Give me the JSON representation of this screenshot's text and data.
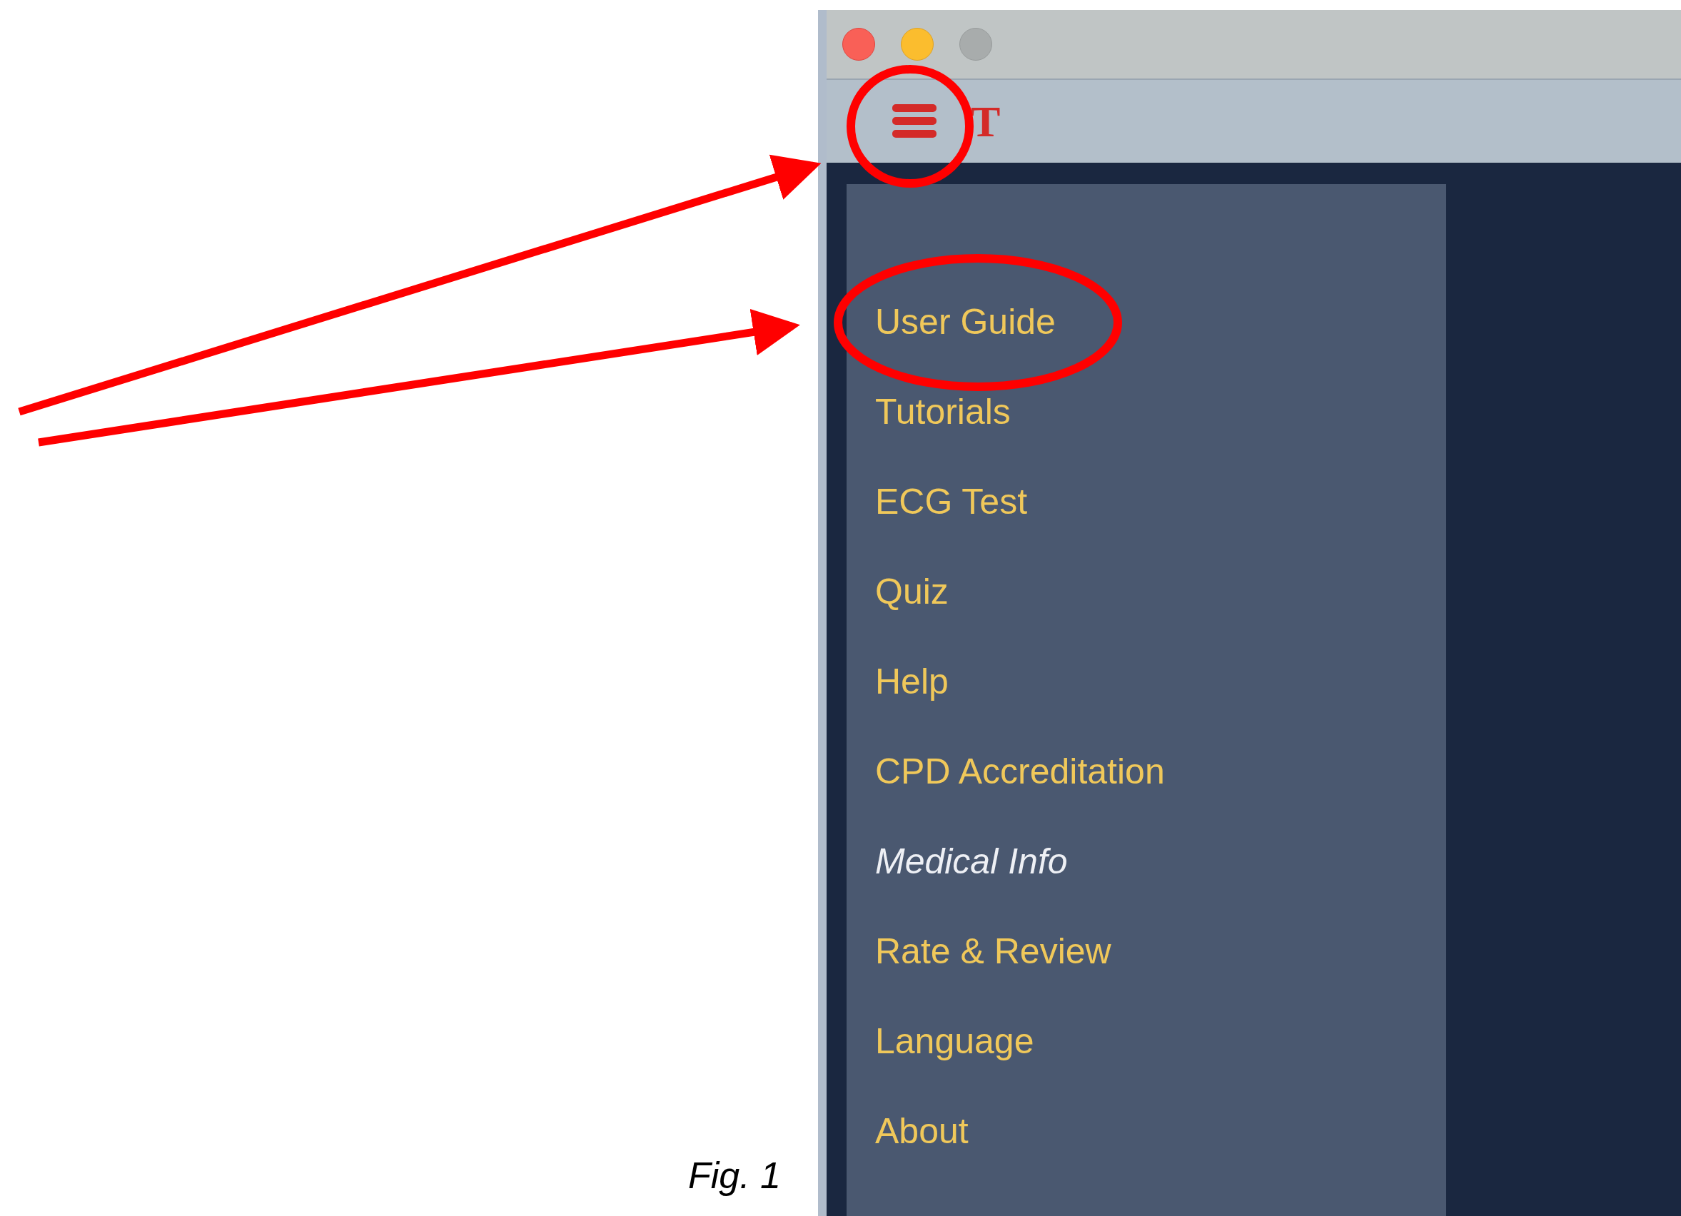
{
  "figure": {
    "caption": "Fig. 1"
  },
  "window": {
    "logo_text": "T"
  },
  "menu": {
    "items": [
      {
        "label": "User Guide",
        "italic": false
      },
      {
        "label": "Tutorials",
        "italic": false
      },
      {
        "label": "ECG Test",
        "italic": false
      },
      {
        "label": "Quiz",
        "italic": false
      },
      {
        "label": "Help",
        "italic": false
      },
      {
        "label": "CPD Accreditation",
        "italic": false
      },
      {
        "label": "Medical Info",
        "italic": true
      },
      {
        "label": "Rate & Review",
        "italic": false
      },
      {
        "label": "Language",
        "italic": false
      },
      {
        "label": "About",
        "italic": false
      }
    ]
  }
}
